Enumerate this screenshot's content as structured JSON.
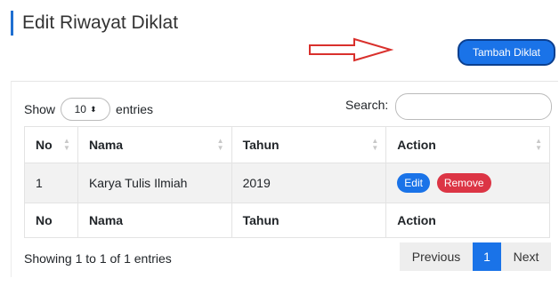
{
  "header": {
    "title": "Edit Riwayat Diklat",
    "add_button": "Tambah Diklat"
  },
  "controls": {
    "show_label": "Show",
    "entries_value": "10",
    "entries_label": "entries",
    "search_label": "Search:",
    "search_value": ""
  },
  "table": {
    "columns": [
      "No",
      "Nama",
      "Tahun",
      "Action"
    ],
    "rows": [
      {
        "no": "1",
        "nama": "Karya Tulis Ilmiah",
        "tahun": "2019",
        "edit": "Edit",
        "remove": "Remove"
      }
    ]
  },
  "footer": {
    "info": "Showing 1 to 1 of 1 entries",
    "pagination": {
      "previous": "Previous",
      "page": "1",
      "next": "Next"
    }
  },
  "colors": {
    "primary": "#1a73e8",
    "danger": "#dc3545",
    "annotation_arrow": "#d9302c"
  }
}
